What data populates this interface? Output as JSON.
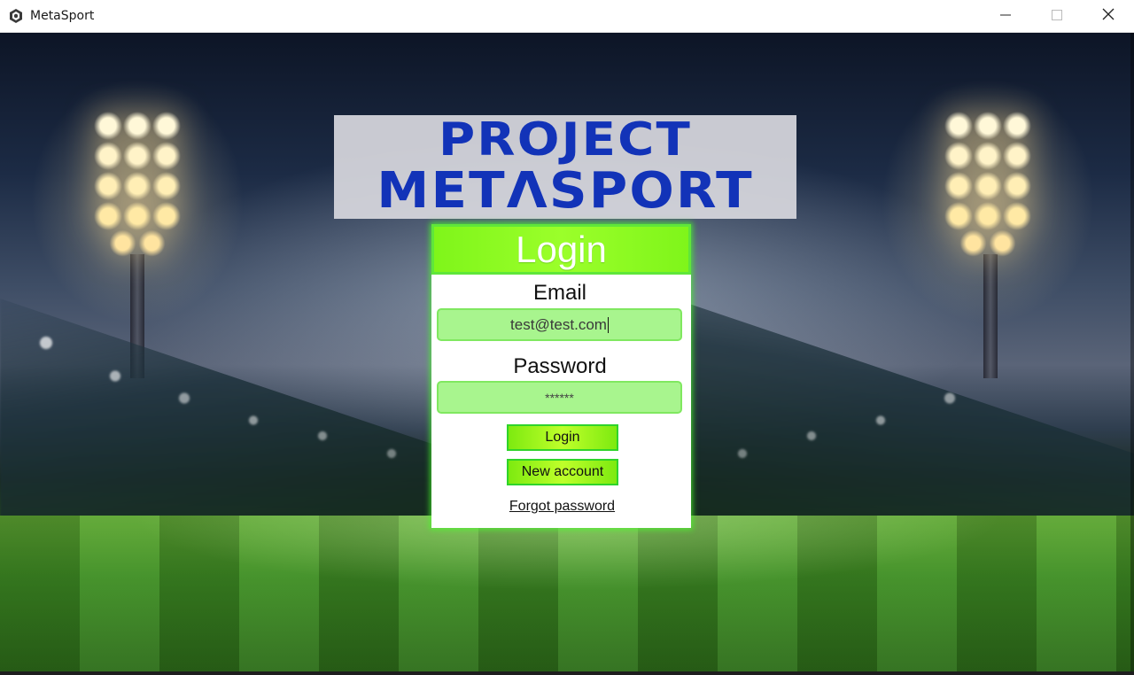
{
  "window": {
    "title": "MetaSport",
    "app_icon": "metasport-app-icon",
    "controls": {
      "minimize_icon": "minimize-icon",
      "maximize_icon": "maximize-icon",
      "close_icon": "close-icon"
    }
  },
  "logo": {
    "line1": "PROJECT",
    "line2": "METΛSPORT",
    "color": "#1233b8"
  },
  "login_form": {
    "title": "Login",
    "email_label": "Email",
    "email_value": "test@test.com",
    "password_label": "Password",
    "password_value": "******",
    "login_button": "Login",
    "new_account_button": "New account",
    "forgot_password_link": "Forgot password",
    "accent_color": "#7ff51a",
    "input_color": "#a8f58e"
  }
}
